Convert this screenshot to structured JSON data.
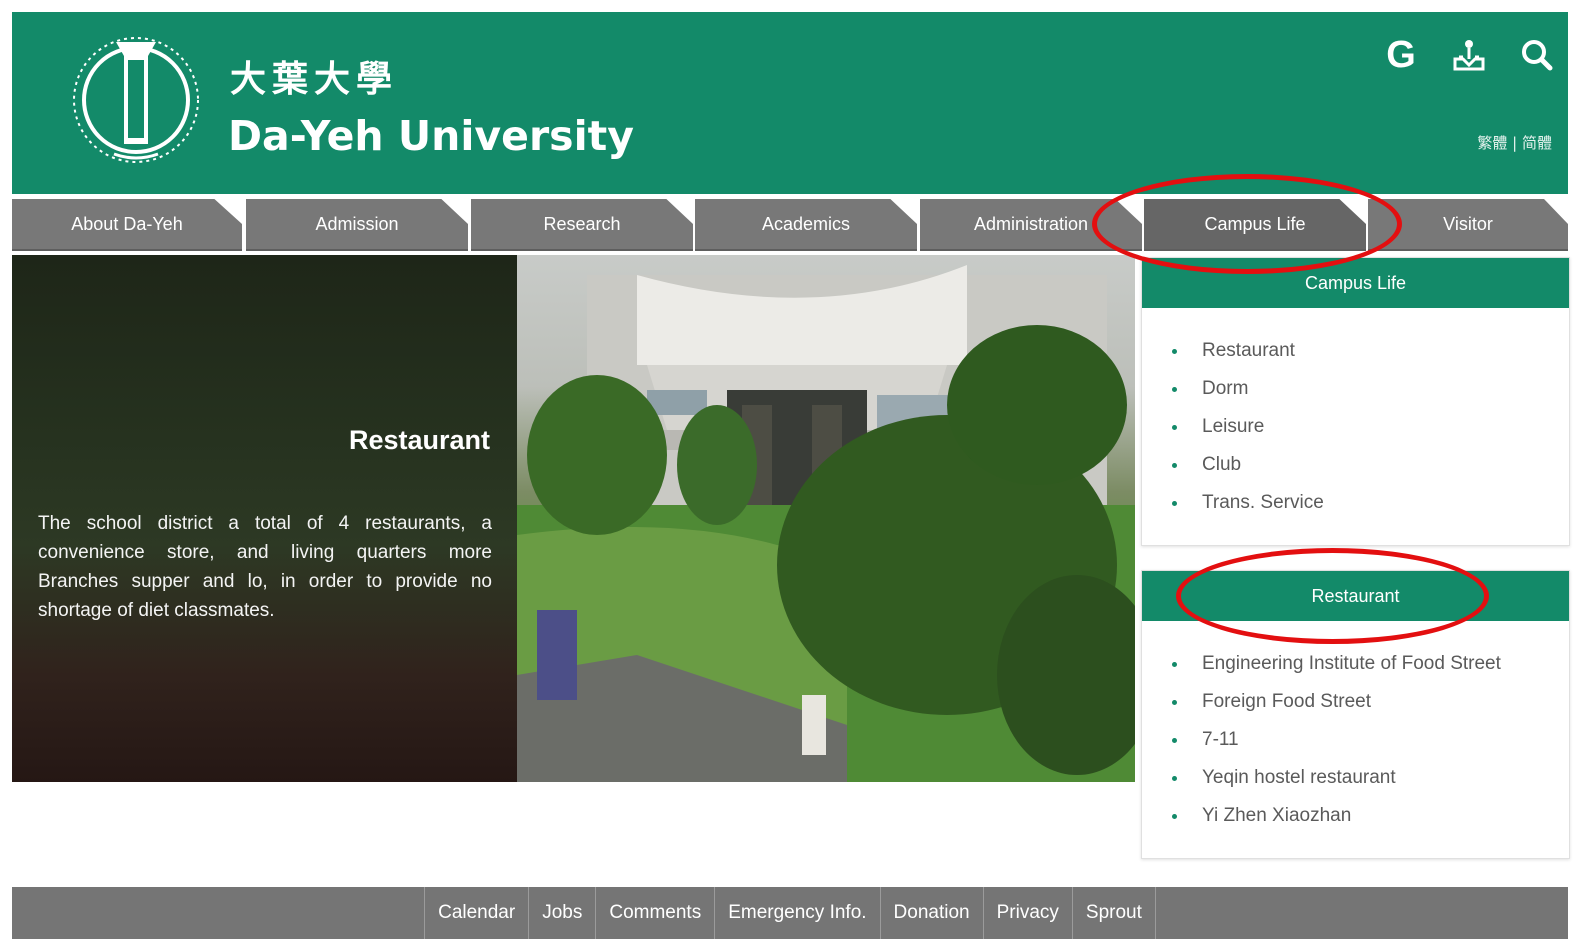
{
  "header": {
    "title_cn": "大葉大學",
    "title_en": "Da-Yeh University",
    "lang_switch": "繁體 | 简體",
    "google_label": "G",
    "icons": [
      "accessibility-icon",
      "search-icon"
    ],
    "brand_color": "#138a69"
  },
  "nav": {
    "tabs": [
      {
        "label": "About Da-Yeh"
      },
      {
        "label": "Admission"
      },
      {
        "label": "Research"
      },
      {
        "label": "Academics"
      },
      {
        "label": "Administration"
      },
      {
        "label": "Campus Life"
      },
      {
        "label": "Visitor"
      }
    ]
  },
  "hero": {
    "title": "Restaurant",
    "text": "The school district a total of 4 restaurants, a convenience store, and living quarters more Branches supper and lo, in order to provide no shortage of diet classmates."
  },
  "campus_panel": {
    "title": "Campus Life",
    "items": [
      {
        "label": "Restaurant"
      },
      {
        "label": "Dorm"
      },
      {
        "label": "Leisure"
      },
      {
        "label": "Club"
      },
      {
        "label": "Trans. Service"
      }
    ]
  },
  "restaurant_panel": {
    "title": "Restaurant",
    "items": [
      {
        "label": "Engineering Institute of Food Street"
      },
      {
        "label": "Foreign Food Street"
      },
      {
        "label": "7-11"
      },
      {
        "label": "Yeqin hostel restaurant"
      },
      {
        "label": "Yi Zhen Xiaozhan"
      }
    ]
  },
  "footer": {
    "links": [
      {
        "label": "Calendar"
      },
      {
        "label": "Jobs"
      },
      {
        "label": "Comments"
      },
      {
        "label": "Emergency Info."
      },
      {
        "label": "Donation"
      },
      {
        "label": "Privacy"
      },
      {
        "label": "Sprout"
      }
    ]
  },
  "annotation_color": "#e30f10"
}
